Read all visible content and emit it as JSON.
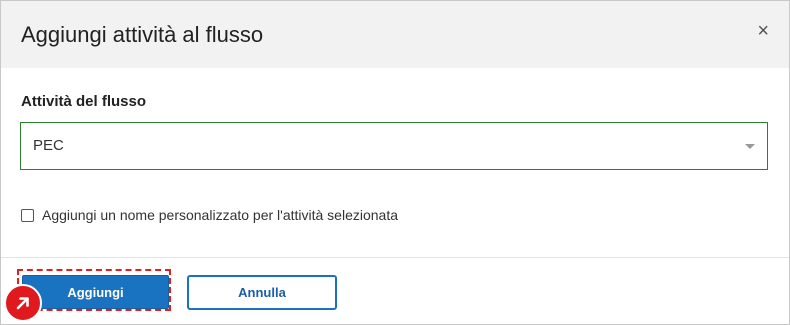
{
  "dialog": {
    "title": "Aggiungi attività al flusso",
    "close_icon": "×"
  },
  "form": {
    "activity_label": "Attività del flusso",
    "activity_value": "PEC",
    "custom_name_label": "Aggiungi un nome personalizzato per l'attività selezionata",
    "custom_name_checked": false
  },
  "footer": {
    "add_label": "Aggiungi",
    "cancel_label": "Annulla"
  },
  "colors": {
    "primary": "#1a73c1",
    "select_border": "#2e7d32",
    "highlight": "#e02020"
  },
  "icons": {
    "close": "close-icon",
    "dropdown": "chevron-down-icon",
    "marker": "arrow-up-right-icon"
  }
}
